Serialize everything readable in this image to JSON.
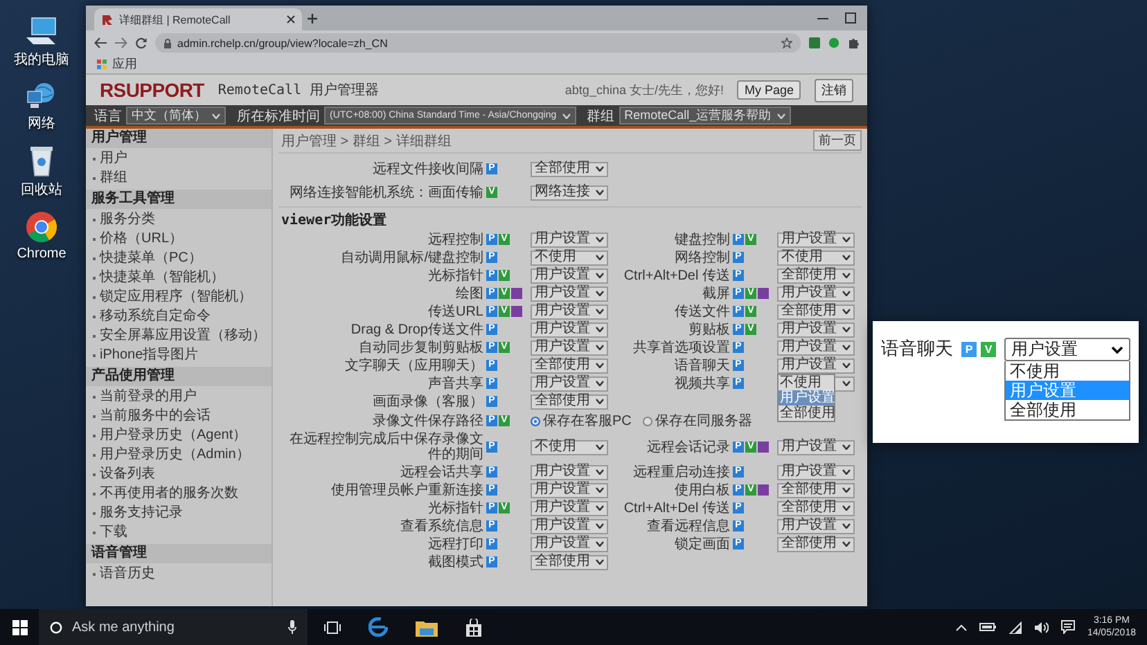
{
  "desktop_icons": [
    {
      "label": "我的电脑",
      "kind": "computer"
    },
    {
      "label": "网络",
      "kind": "network"
    },
    {
      "label": "回收站",
      "kind": "recycle"
    },
    {
      "label": "Chrome",
      "kind": "chrome"
    }
  ],
  "browser": {
    "tab_title": "详细群组 | RemoteCall",
    "url": "admin.rchelp.cn/group/view?locale=zh_CN",
    "bookmark": "应用",
    "page": {
      "logo": "RSUPPORT",
      "app_title": "RemoteCall 用户管理器",
      "greeting": "abtg_china 女士/先生，您好!",
      "header_buttons": [
        "My Page",
        "注销"
      ],
      "toolbar": [
        {
          "label": "语言",
          "value": "中文（简体）"
        },
        {
          "label": "所在标准时间",
          "value": "(UTC+08:00) China Standard Time - Asia/Chongqing"
        },
        {
          "label": "群组",
          "value": "RemoteCall_运营服务帮助"
        }
      ],
      "sidebar": [
        {
          "title": "用户管理",
          "items": [
            "用户",
            "群组"
          ]
        },
        {
          "title": "服务工具管理",
          "items": [
            "服务分类",
            "价格（URL）",
            "快捷菜单（PC）",
            "快捷菜单（智能机）",
            "锁定应用程序（智能机）",
            "移动系统自定命令",
            "安全屏幕应用设置（移动）",
            "iPhone指导图片"
          ]
        },
        {
          "title": "产品使用管理",
          "items": [
            "当前登录的用户",
            "当前服务中的会话",
            "用户登录历史（Agent）",
            "用户登录历史（Admin）",
            "设备列表",
            "不再使用者的服务次数",
            "服务支持记录",
            "下载"
          ]
        },
        {
          "title": "语音管理",
          "items": [
            "语音历史"
          ]
        }
      ],
      "breadcrumb": "用户管理 > 群组 > 详细群组",
      "back_button": "前一页",
      "general_rows": [
        {
          "label": "远程文件接收间隔",
          "badges": [
            {
              "label": "P",
              "color": "#2a7fd4"
            }
          ],
          "value": "全部使用"
        },
        {
          "label": "网络连接智能机系统：画面传输",
          "badges": [
            {
              "label": "V",
              "color": "#2e9b3e"
            }
          ],
          "value": "网络连接"
        }
      ],
      "section_title": "viewer功能设置",
      "rows": [
        {
          "left": {
            "label": "远程控制",
            "badges": [
              {
                "label": "P",
                "color": "#2a7fd4"
              },
              {
                "label": "V",
                "color": "#2e9b3e"
              }
            ],
            "value": "用户设置"
          },
          "right": {
            "label": "键盘控制",
            "badges": [
              {
                "label": "P",
                "color": "#2a7fd4"
              },
              {
                "label": "V",
                "color": "#2e9b3e"
              }
            ],
            "value": "用户设置"
          }
        },
        {
          "left": {
            "label": "自动调用鼠标/键盘控制",
            "badges": [
              {
                "label": "P",
                "color": "#2a7fd4"
              }
            ],
            "value": "不使用"
          },
          "right": {
            "label": "网络控制",
            "badges": [
              {
                "label": "P",
                "color": "#2a7fd4"
              }
            ],
            "value": "不使用"
          }
        },
        {
          "left": {
            "label": "光标指针",
            "badges": [
              {
                "label": "P",
                "color": "#2a7fd4"
              },
              {
                "label": "V",
                "color": "#2e9b3e"
              }
            ],
            "value": "用户设置"
          },
          "right": {
            "label": "Ctrl+Alt+Del 传送",
            "badges": [
              {
                "label": "P",
                "color": "#2a7fd4"
              }
            ],
            "value": "全部使用"
          }
        },
        {
          "left": {
            "label": "绘图",
            "badges": [
              {
                "label": "P",
                "color": "#2a7fd4"
              },
              {
                "label": "V",
                "color": "#2e9b3e"
              },
              {
                "color": "#7a3ea0"
              }
            ],
            "value": "用户设置"
          },
          "right": {
            "label": "截屏",
            "badges": [
              {
                "label": "P",
                "color": "#2a7fd4"
              },
              {
                "label": "V",
                "color": "#2e9b3e"
              },
              {
                "color": "#7a3ea0"
              }
            ],
            "value": "用户设置"
          }
        },
        {
          "left": {
            "label": "传送URL",
            "badges": [
              {
                "label": "P",
                "color": "#2a7fd4"
              },
              {
                "label": "V",
                "color": "#2e9b3e"
              },
              {
                "color": "#7a3ea0"
              }
            ],
            "value": "用户设置"
          },
          "right": {
            "label": "传送文件",
            "badges": [
              {
                "label": "P",
                "color": "#2a7fd4"
              },
              {
                "label": "V",
                "color": "#2e9b3e"
              }
            ],
            "value": "全部使用"
          }
        },
        {
          "left": {
            "label": "Drag & Drop传送文件",
            "badges": [
              {
                "label": "P",
                "color": "#2a7fd4"
              }
            ],
            "value": "用户设置"
          },
          "right": {
            "label": "剪贴板",
            "badges": [
              {
                "label": "P",
                "color": "#2a7fd4"
              },
              {
                "label": "V",
                "color": "#2e9b3e"
              }
            ],
            "value": "用户设置"
          }
        },
        {
          "left": {
            "label": "自动同步复制剪贴板",
            "badges": [
              {
                "label": "P",
                "color": "#2a7fd4"
              },
              {
                "label": "V",
                "color": "#2e9b3e"
              }
            ],
            "value": "用户设置"
          },
          "right": {
            "label": "共享首选项设置",
            "badges": [
              {
                "label": "P",
                "color": "#2a7fd4"
              }
            ],
            "value": "用户设置"
          }
        },
        {
          "left": {
            "label": "文字聊天（应用聊天）",
            "badges": [
              {
                "label": "P",
                "color": "#2a7fd4"
              }
            ],
            "value": "全部使用"
          },
          "right": {
            "label": "语音聊天",
            "badges": [
              {
                "label": "P",
                "color": "#2a7fd4"
              }
            ],
            "value": "用户设置",
            "options": [
              {
                "label": "不使用",
                "selected": false
              },
              {
                "label": "用户设置",
                "selected": true
              },
              {
                "label": "全部使用",
                "selected": false
              }
            ]
          }
        },
        {
          "left": {
            "label": "声音共享",
            "badges": [
              {
                "label": "P",
                "color": "#2a7fd4"
              }
            ],
            "value": "用户设置"
          },
          "right": {
            "label": "视频共享",
            "badges": [
              {
                "label": "P",
                "color": "#2a7fd4"
              }
            ]
          }
        },
        {
          "left": {
            "label": "画面录像（客服）",
            "badges": [
              {
                "label": "P",
                "color": "#2a7fd4"
              }
            ],
            "value": "全部使用"
          }
        },
        {
          "left": {
            "kind": "radio",
            "label": "录像文件保存路径",
            "badges": [
              {
                "label": "P",
                "color": "#2a7fd4"
              },
              {
                "label": "V",
                "color": "#2e9b3e"
              }
            ],
            "choices": [
              {
                "label": "保存在客服PC",
                "selected": true
              },
              {
                "label": "保存在同服务器",
                "selected": false
              }
            ]
          }
        },
        {
          "left": {
            "label": "在远程控制完成后中保存录像文件的期间",
            "badges": [
              {
                "label": "P",
                "color": "#2a7fd4"
              }
            ],
            "value": "不使用"
          },
          "right": {
            "label": "远程会话记录",
            "badges": [
              {
                "label": "P",
                "color": "#2a7fd4"
              },
              {
                "label": "V",
                "color": "#2e9b3e"
              },
              {
                "color": "#7a3ea0"
              }
            ],
            "value": "用户设置"
          }
        },
        {
          "left": {
            "label": "远程会话共享",
            "badges": [
              {
                "label": "P",
                "color": "#2a7fd4"
              }
            ],
            "value": "用户设置"
          },
          "right": {
            "label": "远程重启动连接",
            "badges": [
              {
                "label": "P",
                "color": "#2a7fd4"
              }
            ],
            "value": "用户设置"
          }
        },
        {
          "left": {
            "label": "使用管理员帐户重新连接",
            "badges": [
              {
                "label": "P",
                "color": "#2a7fd4"
              }
            ],
            "value": "用户设置"
          },
          "right": {
            "label": "使用白板",
            "badges": [
              {
                "label": "P",
                "color": "#2a7fd4"
              },
              {
                "label": "V",
                "color": "#2e9b3e"
              },
              {
                "color": "#7a3ea0"
              }
            ],
            "value": "全部使用"
          }
        },
        {
          "left": {
            "label": "光标指针",
            "badges": [
              {
                "label": "P",
                "color": "#2a7fd4"
              },
              {
                "label": "V",
                "color": "#2e9b3e"
              }
            ],
            "value": "用户设置"
          },
          "right": {
            "label": "Ctrl+Alt+Del 传送",
            "badges": [
              {
                "label": "P",
                "color": "#2a7fd4"
              }
            ],
            "value": "全部使用"
          }
        },
        {
          "left": {
            "label": "查看系统信息",
            "badges": [
              {
                "label": "P",
                "color": "#2a7fd4"
              }
            ],
            "value": "用户设置"
          },
          "right": {
            "label": "查看远程信息",
            "badges": [
              {
                "label": "P",
                "color": "#2a7fd4"
              }
            ],
            "value": "用户设置"
          }
        },
        {
          "left": {
            "label": "远程打印",
            "badges": [
              {
                "label": "P",
                "color": "#2a7fd4"
              }
            ],
            "value": "用户设置"
          },
          "right": {
            "label": "锁定画面",
            "badges": [
              {
                "label": "P",
                "color": "#2a7fd4"
              }
            ],
            "value": "全部使用"
          }
        },
        {
          "left": {
            "label": "截图模式",
            "badges": [
              {
                "label": "P",
                "color": "#2a7fd4"
              }
            ],
            "value": "全部使用"
          }
        }
      ]
    }
  },
  "callout": {
    "label": "语音聊天",
    "badges": [
      {
        "label": "P",
        "color": "#3b9cf0"
      },
      {
        "label": "V",
        "color": "#34b34a"
      }
    ],
    "value": "用户设置",
    "options": [
      {
        "label": "不使用",
        "selected": false
      },
      {
        "label": "用户设置",
        "selected": true
      },
      {
        "label": "全部使用",
        "selected": false
      }
    ]
  },
  "taskbar": {
    "search_placeholder": "Ask me anything",
    "time": "3:16 PM",
    "date": "14/05/2018"
  }
}
